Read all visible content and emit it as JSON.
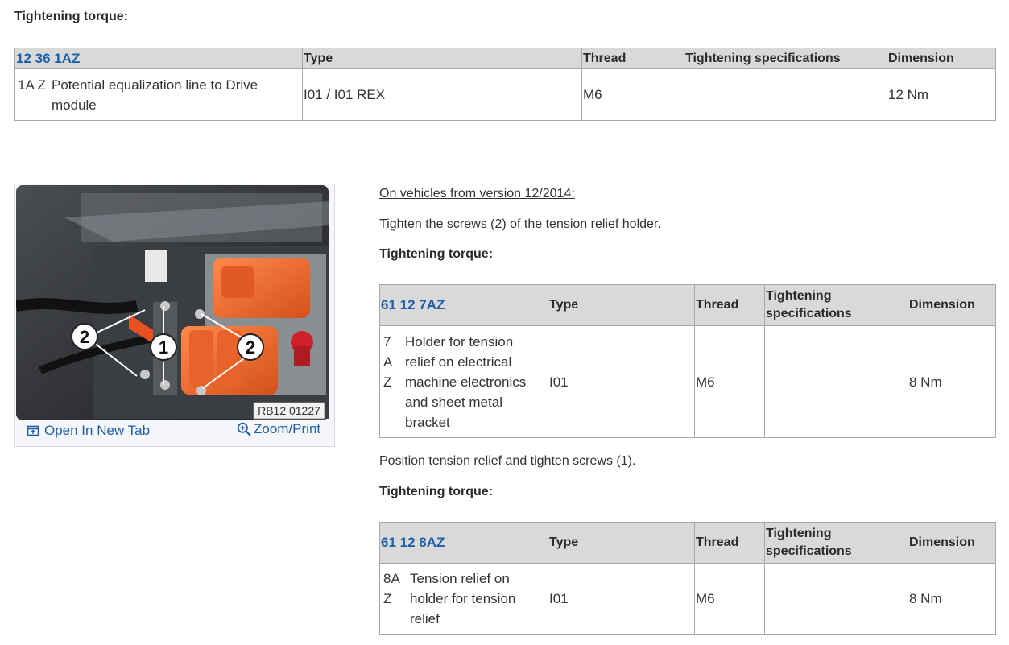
{
  "headings": {
    "torque_top": "Tightening torque:",
    "torque_mid": "Tightening torque:",
    "torque_bottom": "Tightening torque:"
  },
  "table1": {
    "code": "12 36 1AZ",
    "headers": [
      "Type",
      "Thread",
      "Tightening specifications",
      "Dimension"
    ],
    "row": {
      "pos": "1A Z",
      "description": "Potential equalization line to Drive module",
      "type": "I01 / I01 REX",
      "thread": "M6",
      "spec": "",
      "dimension": "12 Nm"
    }
  },
  "figure": {
    "label": "RB12 01227",
    "callouts": [
      "2",
      "1",
      "2"
    ],
    "open_tab": "Open In New Tab",
    "zoom": "Zoom/Print"
  },
  "text": {
    "version_note": "On vehicles from version 12/2014:",
    "step1": "Tighten the screws (2) of the tension relief holder.",
    "step2": "Position tension relief and tighten screws (1)."
  },
  "table2": {
    "code": "61 12 7AZ",
    "headers": [
      "Type",
      "Thread",
      "Tightening specifications",
      "Dimension"
    ],
    "row": {
      "pos": "7 A Z",
      "description": "Holder for tension relief on electrical machine electronics and sheet metal bracket",
      "type": "I01",
      "thread": "M6",
      "spec": "",
      "dimension": "8 Nm"
    }
  },
  "table3": {
    "code": "61 12 8AZ",
    "headers": [
      "Type",
      "Thread",
      "Tightening specifications",
      "Dimension"
    ],
    "row": {
      "pos": "8A Z",
      "description": "Tension relief on holder for tension relief",
      "type": "I01",
      "thread": "M6",
      "spec": "",
      "dimension": "8 Nm"
    }
  },
  "colors": {
    "link": "#1f5fa8",
    "header_bg": "#d9d9d9",
    "component_orange": "#f26a2e"
  }
}
